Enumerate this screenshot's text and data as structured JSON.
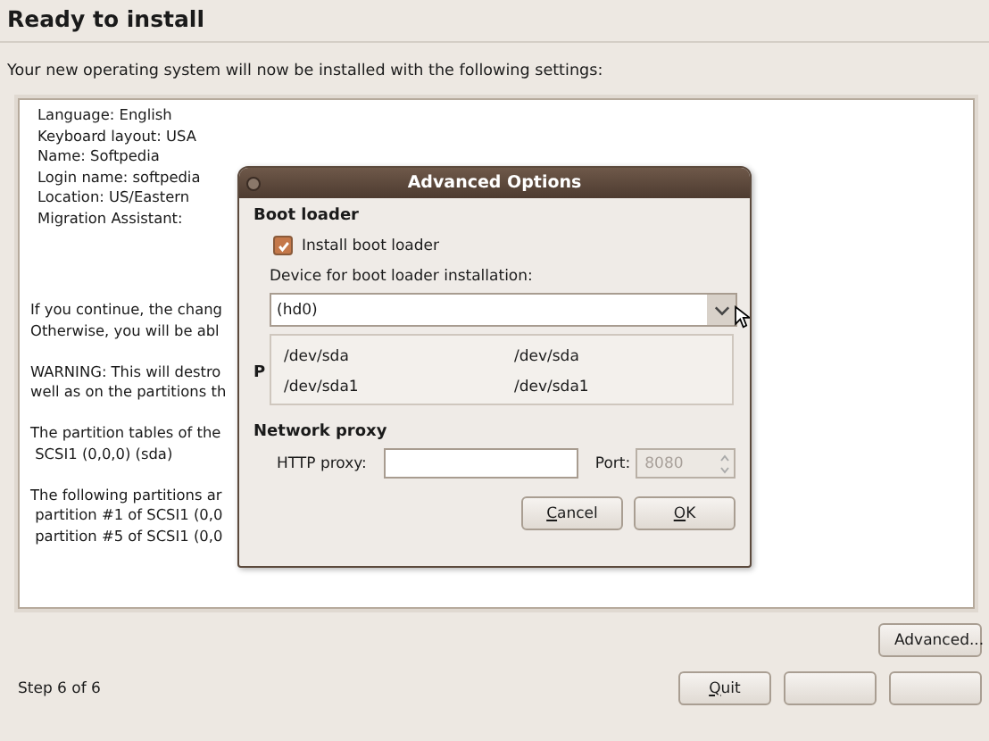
{
  "page": {
    "title": "Ready to install",
    "subtitle": "Your new operating system will now be installed with the following settings:"
  },
  "summary": {
    "lines": [
      "Language: English",
      "Keyboard layout: USA",
      "Name: Softpedia",
      "Login name: softpedia",
      "Location: US/Eastern",
      "Migration Assistant:"
    ],
    "paragraphs": [
      [
        "If you continue, the chang",
        "Otherwise, you will be abl"
      ],
      [
        "WARNING: This will destro",
        "well as on the partitions th"
      ],
      [
        "The partition tables of the",
        " SCSI1 (0,0,0) (sda)"
      ],
      [
        "The following partitions ar",
        " partition #1 of SCSI1 (0,0",
        " partition #5 of SCSI1 (0,0"
      ]
    ]
  },
  "dialog": {
    "title": "Advanced Options",
    "boot_loader": {
      "heading": "Boot loader",
      "install_checkbox": {
        "label": "Install boot loader",
        "checked": true
      },
      "device_label": "Device for boot loader installation:",
      "device_value": "(hd0)",
      "device_options": [
        {
          "columns": [
            "/dev/sda",
            "/dev/sda"
          ]
        },
        {
          "columns": [
            "/dev/sda1",
            "/dev/sda1"
          ]
        }
      ],
      "hidden_heading": "P"
    },
    "network_proxy": {
      "heading": "Network proxy",
      "http_label": "HTTP proxy:",
      "port_label": "Port:",
      "port_value": "8080",
      "port_disabled": true
    },
    "buttons": [
      {
        "label": "Cancel"
      },
      {
        "label": "OK"
      }
    ]
  },
  "advanced_button": "Advanced...",
  "status": {
    "step": "Step 6 of 6"
  },
  "buttons": [
    {
      "label": "Quit"
    }
  ]
}
